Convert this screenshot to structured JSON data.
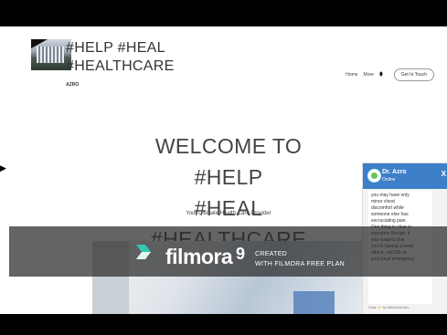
{
  "brand": {
    "title": "#HELP #HEAL\n#HEALTHCARE",
    "subtitle": "AZRO"
  },
  "nav": {
    "home": "Home",
    "more": "More",
    "cta": "Get In Touch"
  },
  "hero": {
    "title": "WELCOME TO #HELP\n#HEAL #HEALTHCARE",
    "subtitle": "Your Ultimate Health Care Provider"
  },
  "chat": {
    "name": "Dr. Azro",
    "status": "Online",
    "close": "X",
    "message": "you may have only\nminor chest\ndiscomfort while\nsomeone else has\nexcruciating pain.\nOne thing is clear in\neveryone though, if\nyou suspect that\nyou're having a heart\nattack, call 911 or\nyour local emergency",
    "footer": "Chat ⚡ by tidiochat.com"
  },
  "watermark": {
    "name": "filmora",
    "version": "9",
    "line1": "CREATED",
    "line2": "WITH FILMORA FREE PLAN"
  },
  "colors": {
    "chat_header": "#3e7fc9",
    "overlay": "#282828"
  },
  "icons": {
    "nav_pin": "location-pin-icon",
    "side_arrow": "arrow-right-icon"
  }
}
